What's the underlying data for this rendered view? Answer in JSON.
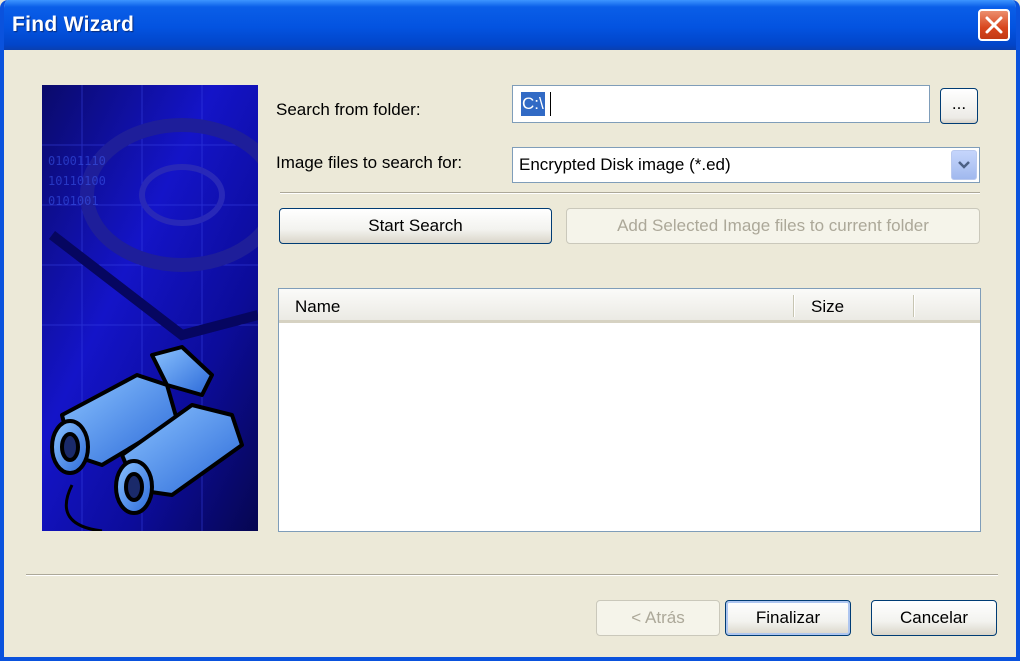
{
  "window": {
    "title": "Find Wizard"
  },
  "search": {
    "folder_label": "Search from folder:",
    "folder_value": "C:\\",
    "browse_label": "...",
    "image_label": "Image files to search for:",
    "image_value": "Encrypted Disk image (*.ed)"
  },
  "actions": {
    "start_search": "Start Search",
    "add_selected": "Add Selected Image files to current folder"
  },
  "results": {
    "columns": [
      "Name",
      "Size"
    ]
  },
  "footer": {
    "back": "< Atrás",
    "finish": "Finalizar",
    "cancel": "Cancelar"
  },
  "colors": {
    "titlebar": "#0353e0",
    "dialog": "#ece9d8",
    "selection": "#316ac5"
  }
}
